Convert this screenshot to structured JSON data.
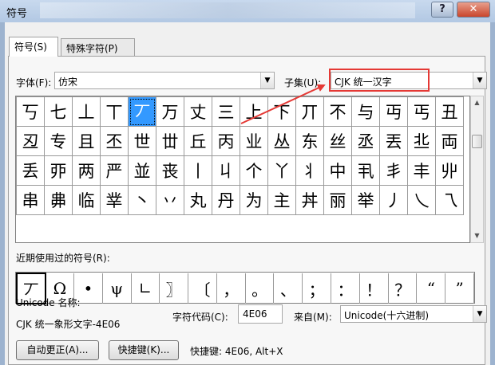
{
  "window": {
    "title": "符号"
  },
  "tabs": [
    {
      "label": "符号(S)"
    },
    {
      "label": "特殊字符(P)"
    }
  ],
  "font": {
    "label": "字体(F):",
    "value": "仿宋"
  },
  "subset": {
    "label": "子集(U):",
    "value": "CJK 统一汉字"
  },
  "grid_chars": [
    [
      "丂",
      "七",
      "丄",
      "丅",
      "丆",
      "万",
      "丈",
      "三",
      "上",
      "下",
      "丌",
      "不",
      "与",
      "丏",
      "丐",
      "丑"
    ],
    [
      "丒",
      "专",
      "且",
      "丕",
      "世",
      "丗",
      "丘",
      "丙",
      "业",
      "丛",
      "东",
      "丝",
      "丞",
      "丟",
      "丠",
      "両"
    ],
    [
      "丢",
      "丣",
      "两",
      "严",
      "並",
      "丧",
      "丨",
      "丩",
      "个",
      "丫",
      "丬",
      "中",
      "丮",
      "丯",
      "丰",
      "丱"
    ],
    [
      "串",
      "丳",
      "临",
      "丵",
      "丶",
      "丷",
      "丸",
      "丹",
      "为",
      "主",
      "丼",
      "丽",
      "举",
      "丿",
      "乀",
      "乁"
    ]
  ],
  "recent": {
    "label": "近期使用过的符号(R):",
    "chars": [
      "丆",
      "Ω",
      "•",
      "ψ",
      "∟",
      "〗",
      "〔",
      "，",
      "。",
      "、",
      "；",
      "：",
      "！",
      "？",
      "“",
      "”"
    ]
  },
  "unicode_name": {
    "label": "Unicode 名称:",
    "value": "CJK 统一象形文字-4E06"
  },
  "char_code": {
    "label": "字符代码(C):",
    "value": "4E06"
  },
  "from": {
    "label": "来自(M):",
    "value": "Unicode(十六进制)"
  },
  "buttons": {
    "autocorrect": "自动更正(A)...",
    "shortcut_key": "快捷键(K)..."
  },
  "shortcut_text": "快捷键: 4E06, Alt+X",
  "icons": {
    "help": "help-icon",
    "close": "close-icon",
    "dropdown": "chevron-down-icon"
  },
  "colors": {
    "selection": "#3399ff",
    "highlight_box": "#e53935",
    "annotation_arrow": "#e53935"
  }
}
